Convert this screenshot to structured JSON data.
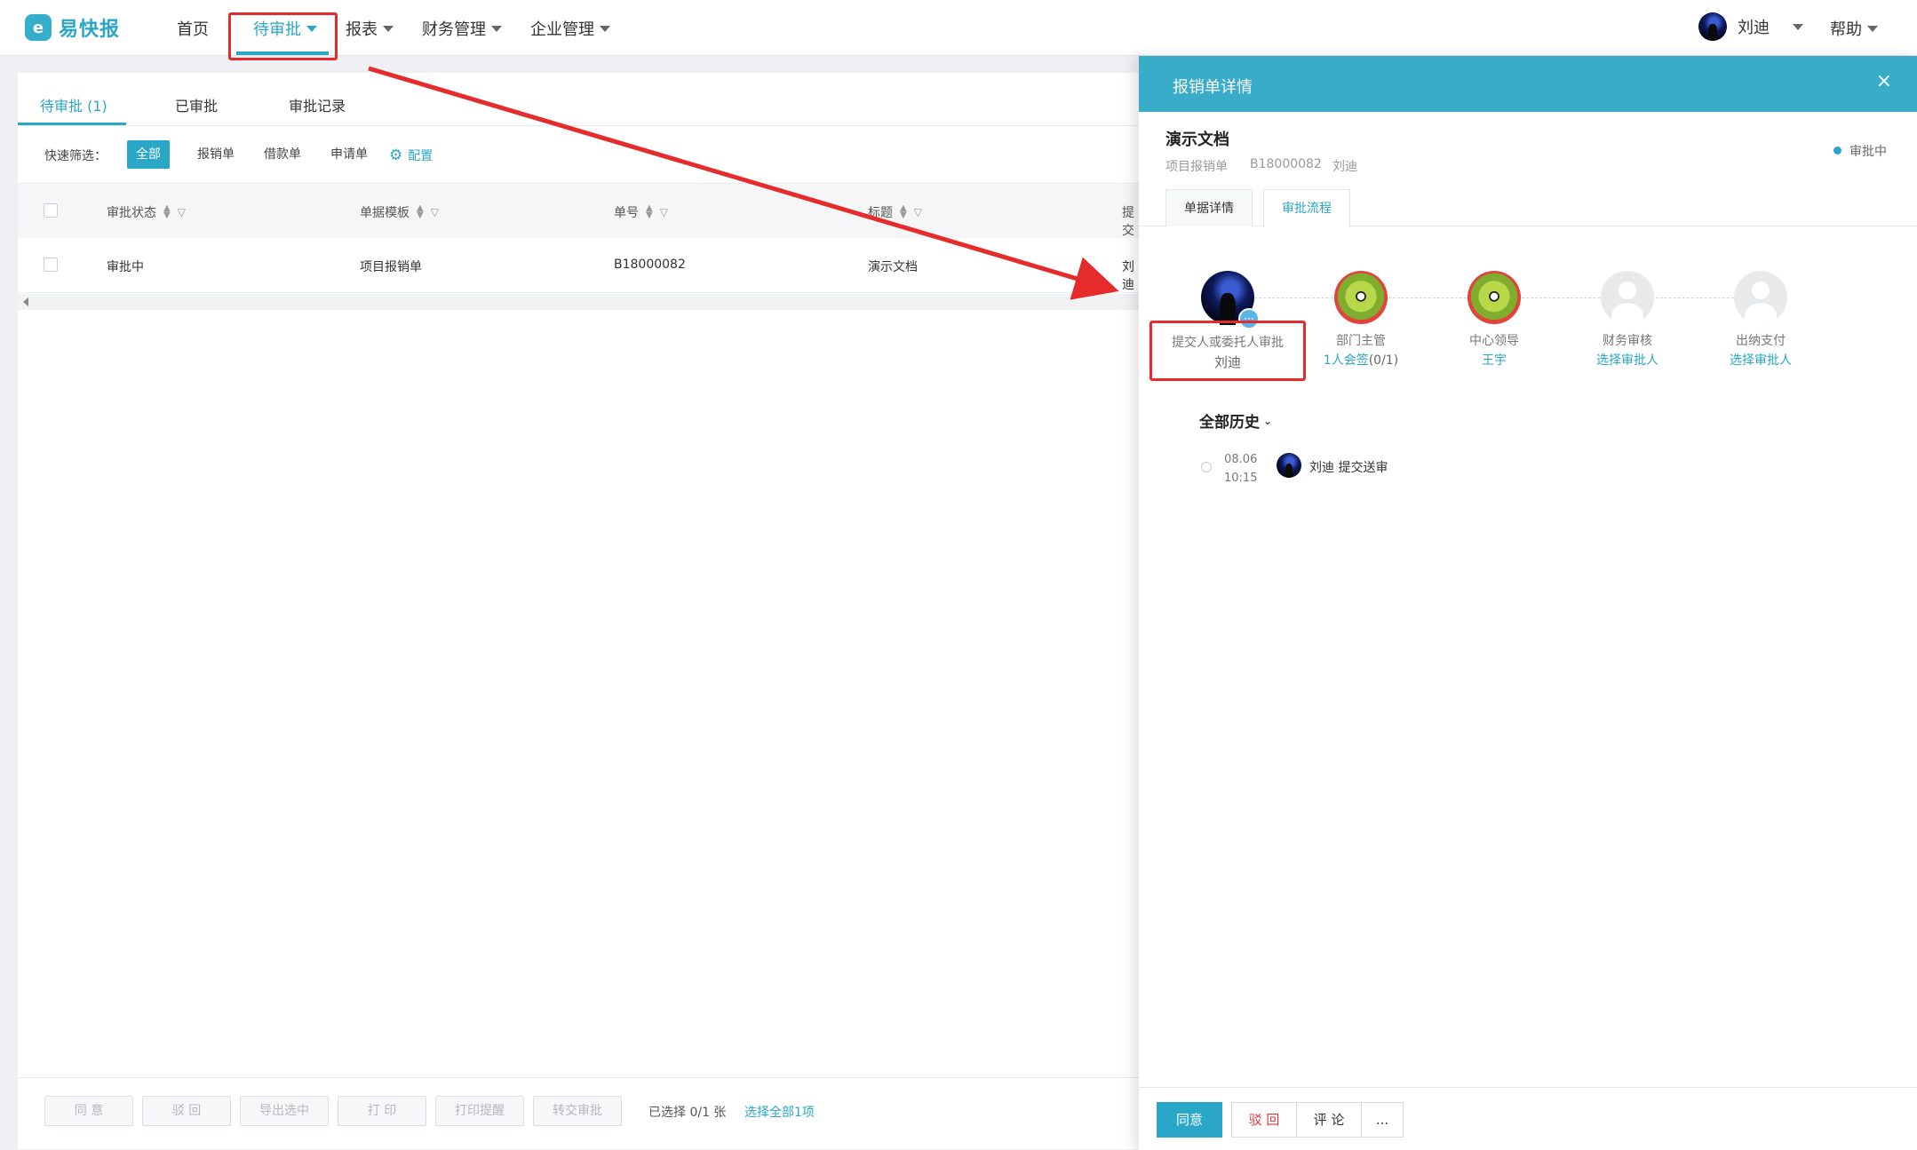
{
  "brand": {
    "logo_glyph": "e",
    "name": "易快报",
    "color": "#2aa6c6"
  },
  "nav": {
    "home": "首页",
    "pending": "待审批",
    "reports": "报表",
    "finance": "财务管理",
    "enterprise": "企业管理",
    "user_name": "刘迪",
    "help": "帮助"
  },
  "list": {
    "tabs": [
      "待审批 (1)",
      "已审批",
      "审批记录"
    ],
    "filter_label": "快速筛选：",
    "filters": [
      "全部",
      "报销单",
      "借款单",
      "申请单"
    ],
    "config": "配置",
    "columns": [
      "审批状态",
      "单据模板",
      "单号",
      "标题",
      "提交"
    ],
    "rows": [
      {
        "status": "审批中",
        "template": "项目报销单",
        "number": "B18000082",
        "title": "演示文档",
        "submitter": "刘迪"
      }
    ],
    "footer_buttons": [
      "同 意",
      "驳 回",
      "导出选中",
      "打 印",
      "打印提醒",
      "转交审批"
    ],
    "selected_info": "已选择 0/1 张",
    "select_all": "选择全部1项"
  },
  "drawer": {
    "header_title": "报销单详情",
    "close_glyph": "×",
    "doc_title": "演示文档",
    "doc_type": "项目报销单",
    "doc_number": "B18000082",
    "doc_owner": "刘迪",
    "status": "审批中",
    "tabs": [
      "单据详情",
      "审批流程"
    ],
    "flow": [
      {
        "role": "提交人或委托人审批",
        "person": "刘迪"
      },
      {
        "role": "部门主管",
        "person": "1人会签",
        "suffix": "(0/1)"
      },
      {
        "role": "中心领导",
        "person": "王宇"
      },
      {
        "role": "财务审核",
        "person": "选择审批人"
      },
      {
        "role": "出纳支付",
        "person": "选择审批人"
      }
    ],
    "history_title": "全部历史",
    "history": [
      {
        "date": "08.06",
        "time": "10:15",
        "text": "刘迪 提交送审"
      }
    ],
    "footer_buttons": {
      "approve": "同意",
      "reject": "驳 回",
      "comment": "评 论",
      "more": "..."
    }
  },
  "colors": {
    "accent": "#2aa6c6",
    "header": "#38acc9",
    "annotation": "#e52b2b"
  }
}
